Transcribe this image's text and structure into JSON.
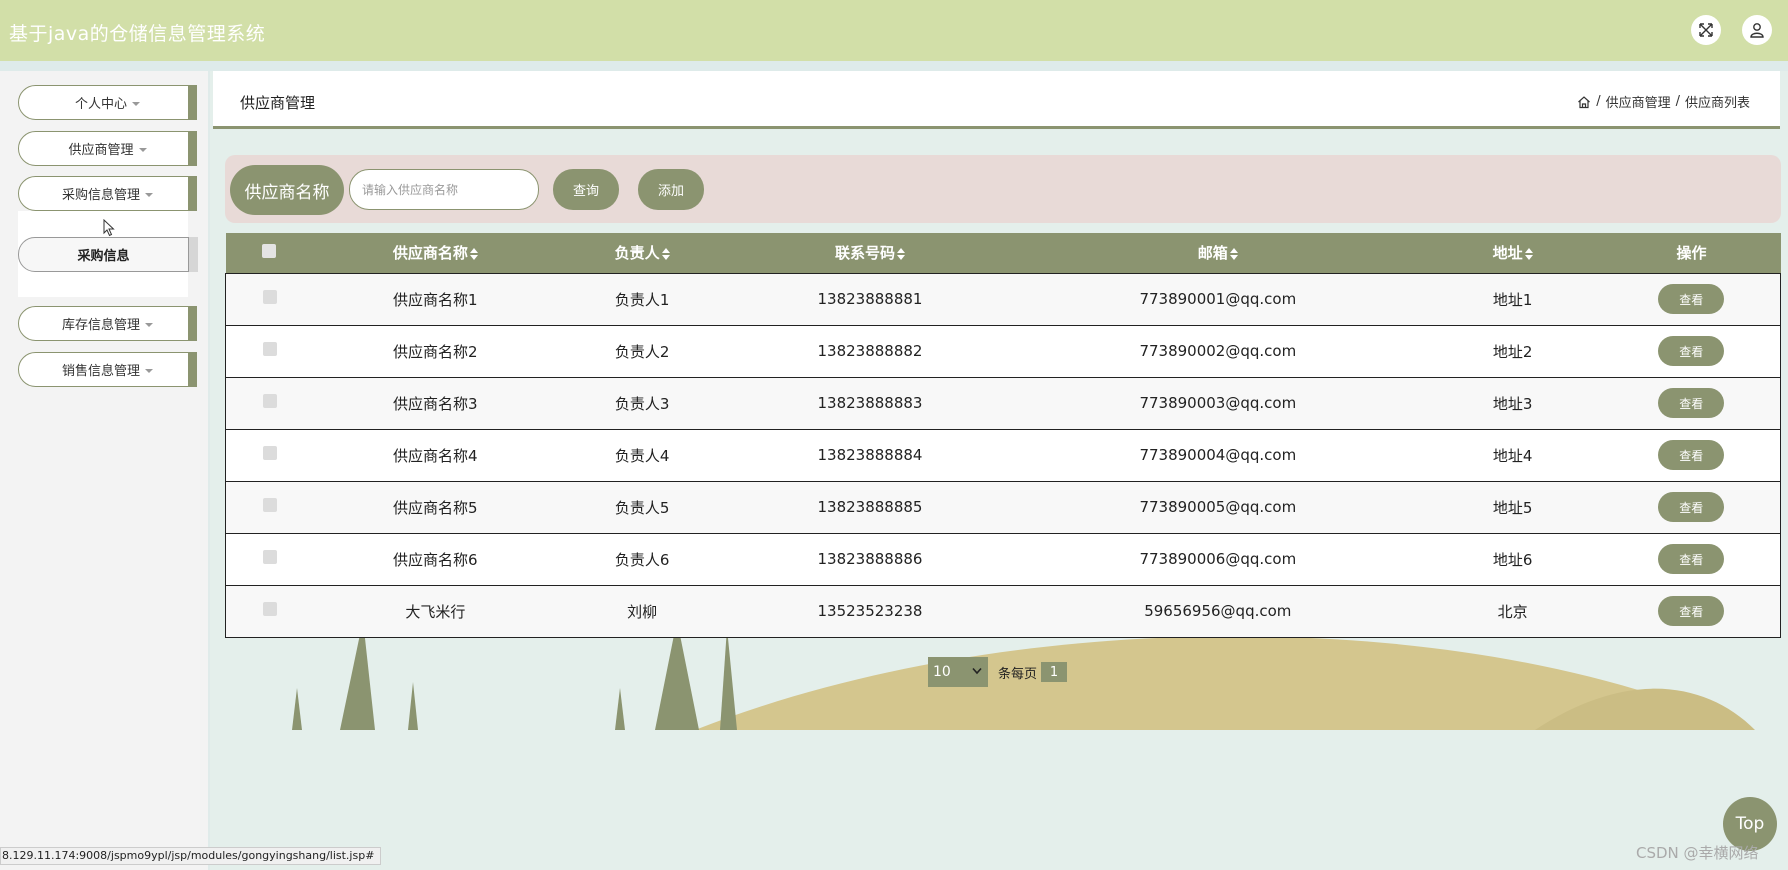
{
  "app": {
    "title": "基于java的仓储信息管理系统"
  },
  "header": {
    "icons": [
      "fullscreen-icon",
      "user-icon"
    ]
  },
  "sidebar": {
    "menus": [
      {
        "label": "个人中心"
      },
      {
        "label": "供应商管理"
      },
      {
        "label": "采购信息管理"
      },
      {
        "label": "库存信息管理"
      },
      {
        "label": "销售信息管理"
      }
    ],
    "submenu": {
      "label": "采购信息"
    }
  },
  "content": {
    "title": "供应商管理",
    "breadcrumb": [
      "供应商管理",
      "供应商列表"
    ],
    "breadcrumb_sep": "/"
  },
  "search": {
    "label": "供应商名称",
    "placeholder": "请输入供应商名称",
    "query_label": "查询",
    "add_label": "添加"
  },
  "table": {
    "columns": [
      "供应商名称",
      "负责人",
      "联系号码",
      "邮箱",
      "地址",
      "操作"
    ],
    "action_label": "查看",
    "rows": [
      {
        "name": "供应商名称1",
        "contact": "负责人1",
        "phone": "13823888881",
        "email": "773890001@qq.com",
        "address": "地址1"
      },
      {
        "name": "供应商名称2",
        "contact": "负责人2",
        "phone": "13823888882",
        "email": "773890002@qq.com",
        "address": "地址2"
      },
      {
        "name": "供应商名称3",
        "contact": "负责人3",
        "phone": "13823888883",
        "email": "773890003@qq.com",
        "address": "地址3"
      },
      {
        "name": "供应商名称4",
        "contact": "负责人4",
        "phone": "13823888884",
        "email": "773890004@qq.com",
        "address": "地址4"
      },
      {
        "name": "供应商名称5",
        "contact": "负责人5",
        "phone": "13823888885",
        "email": "773890005@qq.com",
        "address": "地址5"
      },
      {
        "name": "供应商名称6",
        "contact": "负责人6",
        "phone": "13823888886",
        "email": "773890006@qq.com",
        "address": "地址6"
      },
      {
        "name": "大飞米行",
        "contact": "刘柳",
        "phone": "13523523238",
        "email": "59656956@qq.com",
        "address": "北京"
      }
    ]
  },
  "pagination": {
    "page_size": "10",
    "per_page_label": "条每页",
    "current_page": "1"
  },
  "misc": {
    "top_label": "Top",
    "status_url": "8.129.11.174:9008/jspmo9ypl/jsp/modules/gongyingshang/list.jsp#",
    "watermark": "CSDN @幸横网络"
  },
  "colors": {
    "header_bg": "#d2dfa8",
    "accent": "#8b9470",
    "search_bg": "#e8dad7",
    "page_bg": "#e4efeb",
    "hill": "#d4c68e"
  }
}
